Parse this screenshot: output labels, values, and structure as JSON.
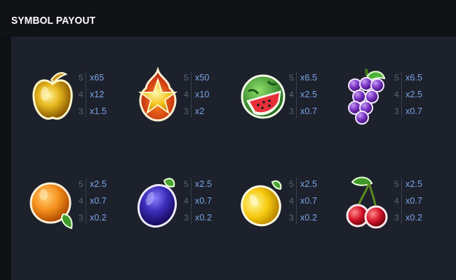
{
  "header": {
    "title": "SYMBOL PAYOUT"
  },
  "symbols": [
    {
      "name": "golden-apple-icon",
      "payouts": [
        {
          "count": "5",
          "mult": "x65"
        },
        {
          "count": "4",
          "mult": "x12"
        },
        {
          "count": "3",
          "mult": "x1.5"
        }
      ]
    },
    {
      "name": "star-icon",
      "payouts": [
        {
          "count": "5",
          "mult": "x50"
        },
        {
          "count": "4",
          "mult": "x10"
        },
        {
          "count": "3",
          "mult": "x2"
        }
      ]
    },
    {
      "name": "watermelon-icon",
      "payouts": [
        {
          "count": "5",
          "mult": "x6.5"
        },
        {
          "count": "4",
          "mult": "x2.5"
        },
        {
          "count": "3",
          "mult": "x0.7"
        }
      ]
    },
    {
      "name": "grapes-icon",
      "payouts": [
        {
          "count": "5",
          "mult": "x6.5"
        },
        {
          "count": "4",
          "mult": "x2.5"
        },
        {
          "count": "3",
          "mult": "x0.7"
        }
      ]
    },
    {
      "name": "orange-icon",
      "payouts": [
        {
          "count": "5",
          "mult": "x2.5"
        },
        {
          "count": "4",
          "mult": "x0.7"
        },
        {
          "count": "3",
          "mult": "x0.2"
        }
      ]
    },
    {
      "name": "plum-icon",
      "payouts": [
        {
          "count": "5",
          "mult": "x2.5"
        },
        {
          "count": "4",
          "mult": "x0.7"
        },
        {
          "count": "3",
          "mult": "x0.2"
        }
      ]
    },
    {
      "name": "lemon-icon",
      "payouts": [
        {
          "count": "5",
          "mult": "x2.5"
        },
        {
          "count": "4",
          "mult": "x0.7"
        },
        {
          "count": "3",
          "mult": "x0.2"
        }
      ]
    },
    {
      "name": "cherries-icon",
      "payouts": [
        {
          "count": "5",
          "mult": "x2.5"
        },
        {
          "count": "4",
          "mult": "x0.7"
        },
        {
          "count": "3",
          "mult": "x0.2"
        }
      ]
    }
  ],
  "colors": {
    "background": "#0f1014",
    "panel": "#1d212c",
    "count_text": "#5b6275",
    "multiplier_text": "#7aa6e6"
  }
}
